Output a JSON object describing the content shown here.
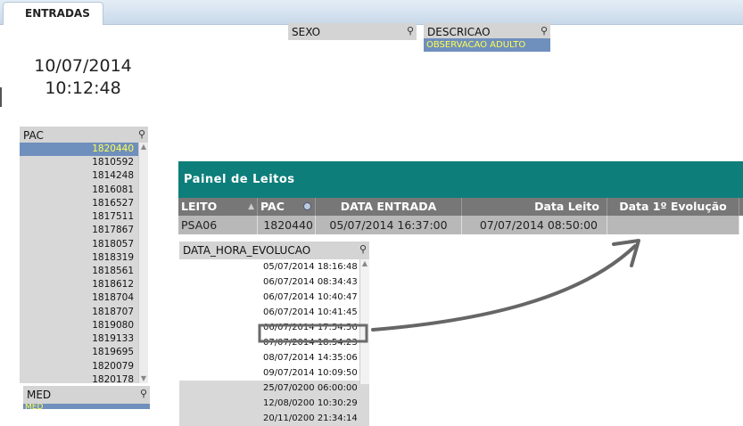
{
  "tabs": [
    {
      "label": "ENTRADAS"
    }
  ],
  "clock": {
    "date": "10/07/2014",
    "time": "10:12:48"
  },
  "sexo": {
    "title": "SEXO"
  },
  "descricao": {
    "title": "DESCRICAO",
    "selected": "OBSERVACAO ADULTO"
  },
  "pac_list": {
    "title": "PAC",
    "items": [
      "1820440",
      "1810592",
      "1814248",
      "1816081",
      "1816527",
      "1817511",
      "1817867",
      "1818057",
      "1818319",
      "1818561",
      "1818612",
      "1818704",
      "1818707",
      "1819080",
      "1819133",
      "1819695",
      "1820079",
      "1820178"
    ],
    "selected_index": 0
  },
  "med": {
    "title": "MED",
    "selected": "MED"
  },
  "painel": {
    "title": "Painel de Leitos",
    "columns": [
      "LEITO",
      "PAC",
      "DATA ENTRADA",
      "Data Leito",
      "Data 1º Evolução"
    ],
    "rows": [
      [
        "PSA06",
        "1820440",
        "05/07/2014 16:37:00",
        "07/07/2014 08:50:00",
        ""
      ]
    ]
  },
  "evolucao": {
    "title": "DATA_HORA_EVOLUCAO",
    "items": [
      {
        "value": "05/07/2014 18:16:48",
        "excluded": false
      },
      {
        "value": "06/07/2014 08:34:43",
        "excluded": false
      },
      {
        "value": "06/07/2014 10:40:47",
        "excluded": false
      },
      {
        "value": "06/07/2014 10:41:45",
        "excluded": false
      },
      {
        "value": "06/07/2014 17:54:56",
        "excluded": false
      },
      {
        "value": "07/07/2014 18:54:23",
        "excluded": false,
        "highlighted": true
      },
      {
        "value": "08/07/2014 14:35:06",
        "excluded": false
      },
      {
        "value": "09/07/2014 10:09:50",
        "excluded": false
      },
      {
        "value": "25/07/0200 06:00:00",
        "excluded": true
      },
      {
        "value": "12/08/0200 10:30:29",
        "excluded": true
      },
      {
        "value": "20/11/0200 21:34:14",
        "excluded": true
      }
    ]
  },
  "colors": {
    "teal": "#0e7e7b",
    "selection": "#6f8fbd",
    "selected_text": "#ffff50",
    "header_grey": "#777777",
    "arrow": "#666666"
  }
}
